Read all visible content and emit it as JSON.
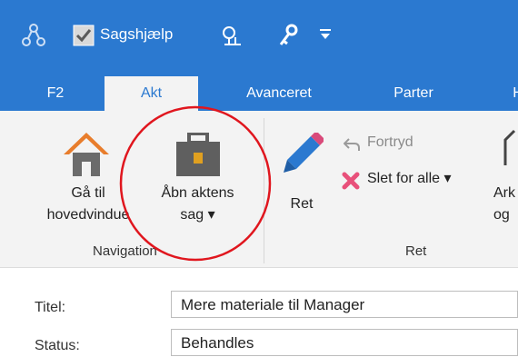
{
  "quick_access": {
    "sagshjaelp_label": "Sagshjælp",
    "icons": [
      "sitemap-icon",
      "checkbox-checked-icon",
      "tree-icon",
      "key-icon",
      "dropdown-arrow-icon"
    ]
  },
  "tabs": [
    {
      "label": "F2",
      "active": false
    },
    {
      "label": "Akt",
      "active": true
    },
    {
      "label": "Avanceret",
      "active": false
    },
    {
      "label": "Parter",
      "active": false
    },
    {
      "label": "H",
      "active": false
    }
  ],
  "ribbon": {
    "navigation": {
      "group_label": "Navigation",
      "goto_line1": "Gå til",
      "goto_line2": "hovedvindue",
      "open_line1": "Åbn aktens",
      "open_line2": "sag ▾"
    },
    "ret": {
      "group_label": "Ret",
      "ret_label": "Ret",
      "undo_label": "Fortryd",
      "delete_label": "Slet for alle ▾",
      "partial_line1": "Ark",
      "partial_line2": "og"
    }
  },
  "form": {
    "title_label": "Titel:",
    "title_value": "Mere materiale til Manager",
    "status_label": "Status:",
    "status_value": "Behandles"
  },
  "colors": {
    "accent": "#2b79d0",
    "ribbon_bg": "#f3f3f3",
    "highlight_circle": "#e0161e"
  }
}
